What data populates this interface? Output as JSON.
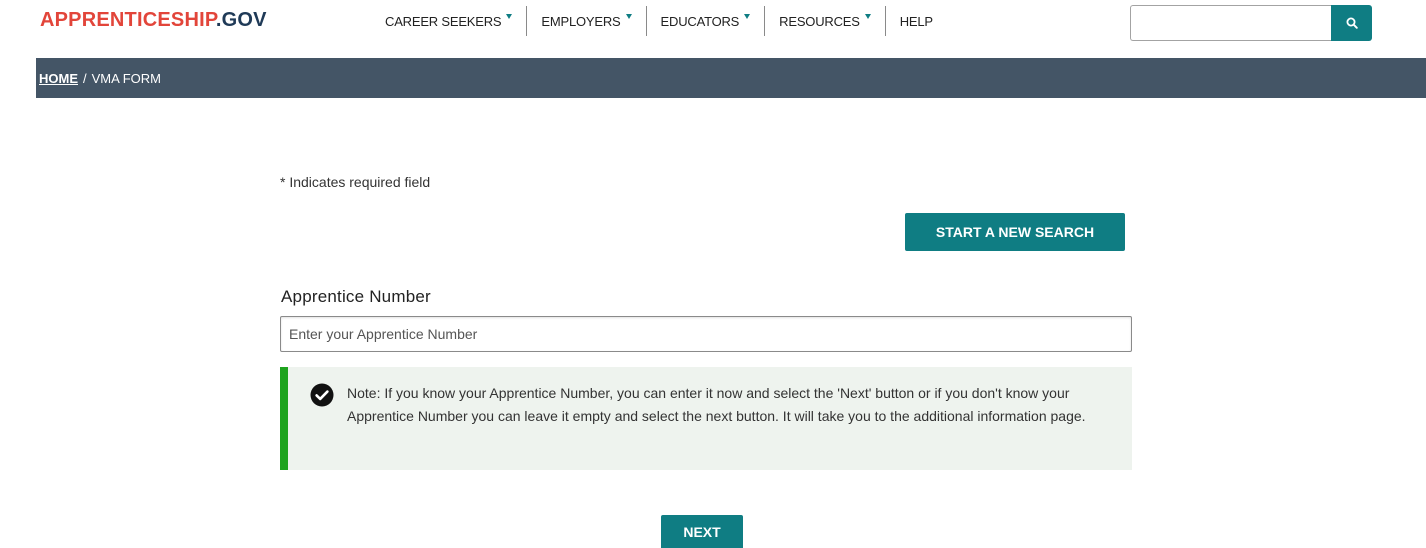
{
  "header": {
    "logo_main": "APPRENTICESHIP",
    "logo_tld": ".GOV",
    "nav": [
      {
        "label": "CAREER SEEKERS",
        "has_dropdown": true
      },
      {
        "label": "EMPLOYERS",
        "has_dropdown": true
      },
      {
        "label": "EDUCATORS",
        "has_dropdown": true
      },
      {
        "label": "RESOURCES",
        "has_dropdown": true
      },
      {
        "label": "HELP",
        "has_dropdown": false
      }
    ],
    "search": {
      "value": "",
      "placeholder": "",
      "icon": "search-icon"
    }
  },
  "breadcrumb": {
    "home": "HOME",
    "separator": "/",
    "current": "VMA FORM"
  },
  "form": {
    "required_note": "* Indicates required field",
    "new_search_label": "START A NEW SEARCH",
    "apprentice_label": "Apprentice Number",
    "apprentice_value": "",
    "apprentice_placeholder": "Enter your Apprentice Number",
    "note_icon": "check-circle-icon",
    "note_text": "Note: If you know your Apprentice Number, you can enter it now and select the 'Next' button or if you don't know your Apprentice Number you can leave it empty and select the next button. It will take you to the additional information page.",
    "next_label": "NEXT"
  },
  "colors": {
    "brand_red": "#e2453a",
    "brand_navy": "#1f3a57",
    "accent_teal": "#0f7d83",
    "breadcrumb_bg": "#445566",
    "note_border": "#1ea31e",
    "note_bg": "#eef3ee"
  }
}
